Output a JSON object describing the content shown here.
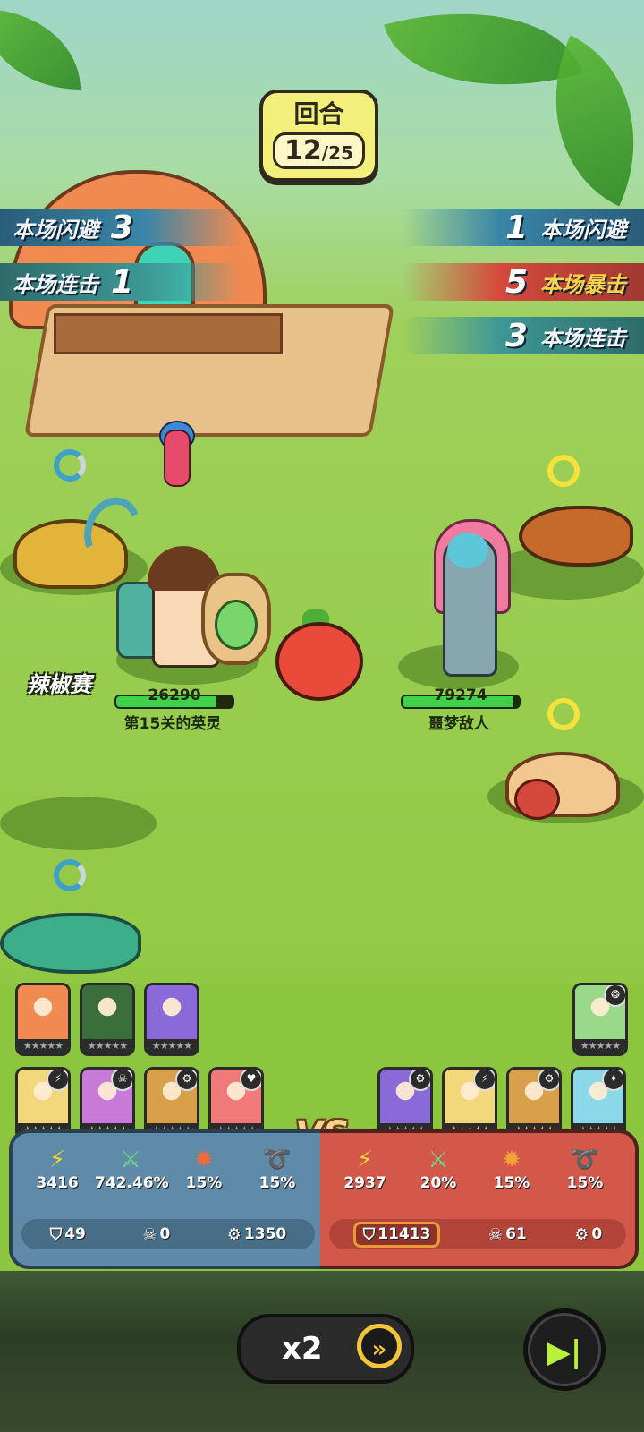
{
  "round": {
    "title": "回合",
    "current": "12",
    "total": "/25"
  },
  "left_stats": [
    {
      "label": "本场闪避",
      "value": "3"
    },
    {
      "label": "本场连击",
      "value": "1"
    }
  ],
  "right_stats": [
    {
      "label": "本场闪避",
      "value": "1"
    },
    {
      "label": "本场暴击",
      "value": "5"
    },
    {
      "label": "本场连击",
      "value": "3"
    }
  ],
  "player": {
    "hp": "26290",
    "hp_fraction": 0.85,
    "name": "第15关的英灵",
    "tag": "辣椒赛"
  },
  "enemy": {
    "hp": "79274",
    "hp_fraction": 0.95,
    "name": "噩梦敌人"
  },
  "left_cards_top": [
    {
      "color": "#f08a50",
      "stars": "★★★★★",
      "grey": true
    },
    {
      "color": "#3a6e3a",
      "stars": "★★★★★",
      "grey": true
    },
    {
      "color": "#8a6ad8",
      "stars": "★★★★★",
      "grey": true
    }
  ],
  "left_cards_bottom": [
    {
      "color": "#f2d87a",
      "stars": "★★★★★",
      "grey": false,
      "badge": "⚡"
    },
    {
      "color": "#c87ad8",
      "stars": "★★★★★",
      "grey": false,
      "badge": "☠"
    },
    {
      "color": "#d8a04a",
      "stars": "★★★★★",
      "grey": true,
      "badge": "⚙"
    },
    {
      "color": "#f07a7a",
      "stars": "★★★★★",
      "grey": true,
      "badge": "♥"
    }
  ],
  "right_cards_top": [
    {
      "color": "#9ad88a",
      "stars": "★★★★★",
      "grey": true,
      "badge": "❂"
    }
  ],
  "right_cards_bottom": [
    {
      "color": "#8a6ad8",
      "stars": "★★★★★",
      "grey": true,
      "badge": "⚙"
    },
    {
      "color": "#f2d87a",
      "stars": "★★★★★",
      "grey": false,
      "badge": "⚡"
    },
    {
      "color": "#d8a04a",
      "stars": "★★★★★",
      "grey": false,
      "badge": "⚙"
    },
    {
      "color": "#8ad8e8",
      "stars": "★★★★★",
      "grey": true,
      "badge": "✦"
    }
  ],
  "vs": "VS",
  "left_panel": {
    "stats": [
      "3416",
      "742.46%",
      "15%",
      "15%"
    ],
    "defense": "49",
    "skull": "0",
    "gear": "1350"
  },
  "right_panel": {
    "stats": [
      "2937",
      "20%",
      "15%",
      "15%"
    ],
    "defense": "11413",
    "skull": "61",
    "gear": "0"
  },
  "controls": {
    "speed": "x2",
    "speed_icon": "»",
    "skip_icon": "▶|"
  },
  "colors": {
    "accent_yellow": "#f2c43a",
    "hp_green": "#3fd14a"
  }
}
